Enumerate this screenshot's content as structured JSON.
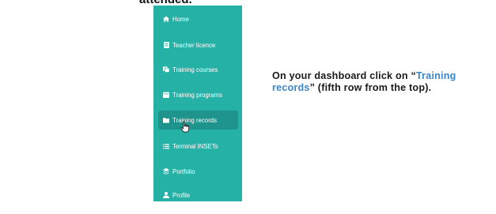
{
  "top_text": "attended.",
  "sidebar": {
    "items": [
      {
        "label": "Home",
        "icon": "home-icon"
      },
      {
        "label": "Teacher licence",
        "icon": "licence-icon"
      },
      {
        "label": "Training courses",
        "icon": "courses-icon"
      },
      {
        "label": "Training programs",
        "icon": "calendar-icon"
      },
      {
        "label": "Training records",
        "icon": "folder-icon"
      },
      {
        "label": "Terminal INSETs",
        "icon": "list-icon"
      },
      {
        "label": "Portfolio",
        "icon": "layers-icon"
      },
      {
        "label": "Profile",
        "icon": "user-icon"
      }
    ],
    "active_index": 4
  },
  "instruction": {
    "before": "On your dashboard click on “",
    "highlight": "Training records",
    "after": "” (fifth row from the top)."
  },
  "colors": {
    "sidebar_bg": "#26b1a7",
    "active_bg": "#1e948c",
    "highlight": "#3b86c6"
  }
}
